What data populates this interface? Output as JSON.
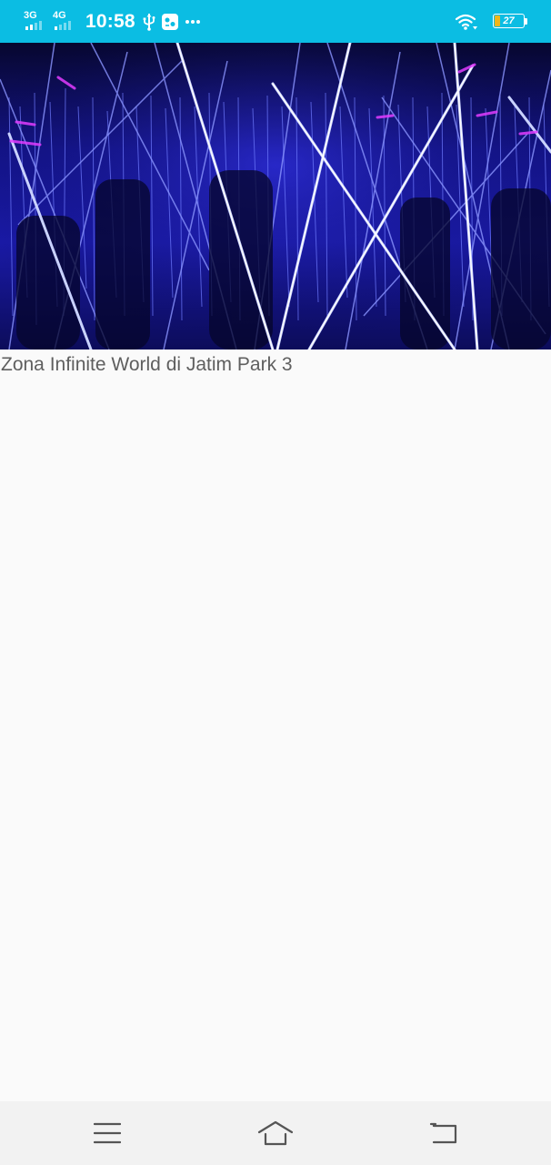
{
  "status_bar": {
    "network_1": "3G",
    "network_2": "4G",
    "time": "10:58",
    "battery_level": 0.2,
    "battery_text": "27",
    "background_color": "#0bbde3",
    "icons": [
      "signal-3g-icon",
      "signal-4g-icon",
      "usb-icon",
      "app-notification-icon",
      "more-dots-icon",
      "wifi-icon",
      "battery-icon"
    ]
  },
  "content": {
    "caption": "Zona Infinite World di Jatim Park 3"
  },
  "nav_bar": {
    "buttons": [
      "menu-button",
      "home-button",
      "back-button"
    ]
  }
}
